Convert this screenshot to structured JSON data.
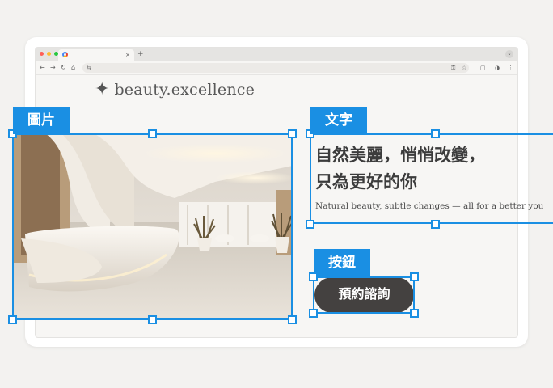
{
  "browser": {
    "tab_close": "×",
    "new_tab": "+",
    "tab_menu": "⌄",
    "nav": {
      "back": "←",
      "forward": "→",
      "reload": "↻",
      "home": "⌂"
    },
    "window_controls": [
      "#ff5f57",
      "#febc2e",
      "#28c840"
    ]
  },
  "site": {
    "logo_star": "✦",
    "logo_text": "beauty.excellence"
  },
  "labels": {
    "image": "圖片",
    "text": "文字",
    "button": "按鈕"
  },
  "hero": {
    "title_line1": "自然美麗，悄悄改變，",
    "title_line2": "只為更好的你",
    "subtitle": "Natural beauty, subtle changes — all for a better you",
    "cta": "預約諮詢"
  },
  "colors": {
    "selection": "#1a8fe3",
    "cta_bg": "#444140",
    "page_bg": "#f7f6f4"
  },
  "icons": [
    "sparkle-icon",
    "tune-icon",
    "key-icon",
    "star-icon",
    "extension-icon",
    "profile-icon",
    "more-icon"
  ]
}
